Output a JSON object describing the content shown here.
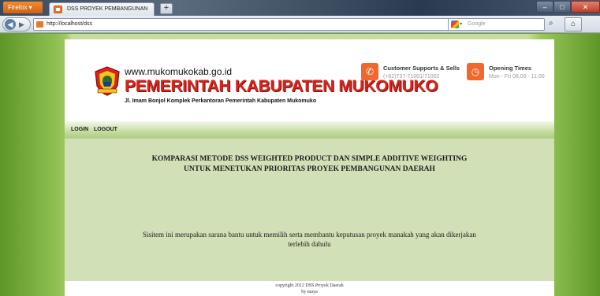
{
  "browser": {
    "menu_button": "Firefox ▾",
    "tab_title": "DSS PROYEK PEMBANGUNAN",
    "new_tab": "+",
    "url": "http://localhost/dss",
    "search_placeholder": "Google"
  },
  "header": {
    "site_url": "www.mukomukokab.go.id",
    "site_name": "PEMERINTAH KABUPATEN MUKOMUKO",
    "address": "Jl. Imam Bonjol Komplek Perkantoran Pemerintah Kabupaten Mukomuko",
    "support_title": "Customer Supports & Sells",
    "support_phone": "(+62)737-71001/71002",
    "hours_title": "Opening Times",
    "hours_text": "Mon - Fri 08.00 - 11.00"
  },
  "menu": {
    "login": "LOGIN",
    "logout": "LOGOUT"
  },
  "content": {
    "title_line1": "KOMPARASI METODE DSS WEIGHTED PRODUCT DAN SIMPLE ADDITIVE WEIGHTING",
    "title_line2": "UNTUK MENETUKAN PRIORITAS  PROYEK PEMBANGUNAN DAERAH",
    "description_line1": "Sisitem ini merupakan sarana bantu untuk memilih serta membantu keputusan proyek manakah yang akan dikerjakan",
    "description_line2": "terlebih dahulu"
  },
  "footer": {
    "copyright": "copyright 2012 DSS Proyek Daerah",
    "author": "by maya"
  },
  "colors": {
    "accent_orange": "#f0682c",
    "brand_red": "#d8241c",
    "content_bg": "#d2e0b8",
    "page_green": "#6f9f3a"
  }
}
